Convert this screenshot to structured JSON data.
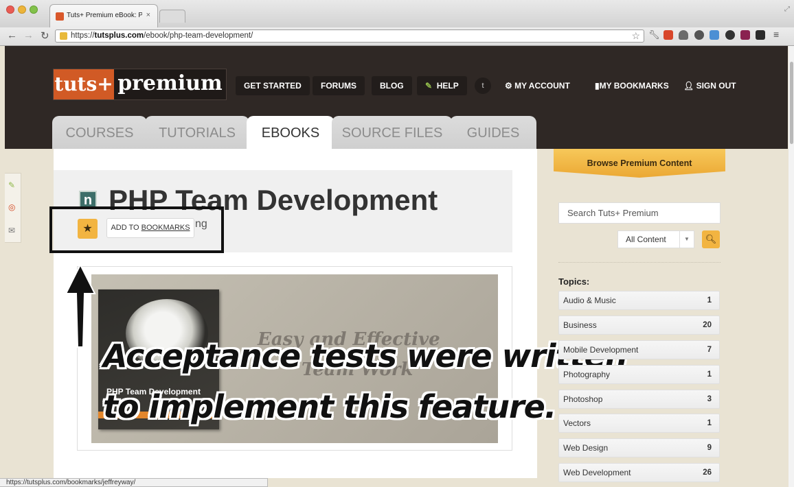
{
  "browser": {
    "tab_title": "Tuts+ Premium eBook: PHP",
    "tab_close": "×",
    "url_scheme": "https://",
    "url_host": "tutsplus.com",
    "url_path": "/ebook/php-team-development/",
    "status_url": "https://tutsplus.com/bookmarks/jeffreyway/"
  },
  "header": {
    "logo_left": "tuts+",
    "logo_right": "premium",
    "nav": {
      "get_started": "GET STARTED",
      "forums": "FORUMS",
      "blog": "BLOG",
      "help": "HELP",
      "my_account": "MY ACCOUNT",
      "my_bookmarks": "MY BOOKMARKS",
      "sign_out": "SIGN OUT"
    },
    "tabs": [
      {
        "label": "COURSES"
      },
      {
        "label": "TUTORIALS"
      },
      {
        "label": "EBOOKS",
        "active": true
      },
      {
        "label": "SOURCE FILES"
      },
      {
        "label": "GUIDES"
      }
    ]
  },
  "main": {
    "badge_letter": "n",
    "title": "PHP Team Development",
    "bookmark_tooltip_prefix": "ADD TO ",
    "bookmark_tooltip_link": "BOOKMARKS",
    "author_fragment": "ng",
    "cover": {
      "book_title": "PHP Team Development",
      "subtitle_line1": "Easy and Effective",
      "subtitle_line2": "Team Work"
    },
    "annotation": {
      "line1": "Acceptance tests were written",
      "line2": "to implement this feature."
    }
  },
  "sidebar": {
    "browse_button": "Browse Premium Content",
    "search_placeholder": "Search Tuts+ Premium",
    "content_filter": "All Content",
    "topics_title": "Topics:",
    "topics": [
      {
        "label": "Audio & Music",
        "count": "1"
      },
      {
        "label": "Business",
        "count": "20"
      },
      {
        "label": "Mobile Development",
        "count": "7"
      },
      {
        "label": "Photography",
        "count": "1"
      },
      {
        "label": "Photoshop",
        "count": "3"
      },
      {
        "label": "Vectors",
        "count": "1"
      },
      {
        "label": "Web Design",
        "count": "9"
      },
      {
        "label": "Web Development",
        "count": "26"
      }
    ]
  },
  "colors": {
    "header_bg": "#2f2825",
    "accent_orange": "#d15a25",
    "accent_yellow": "#f2b441"
  }
}
